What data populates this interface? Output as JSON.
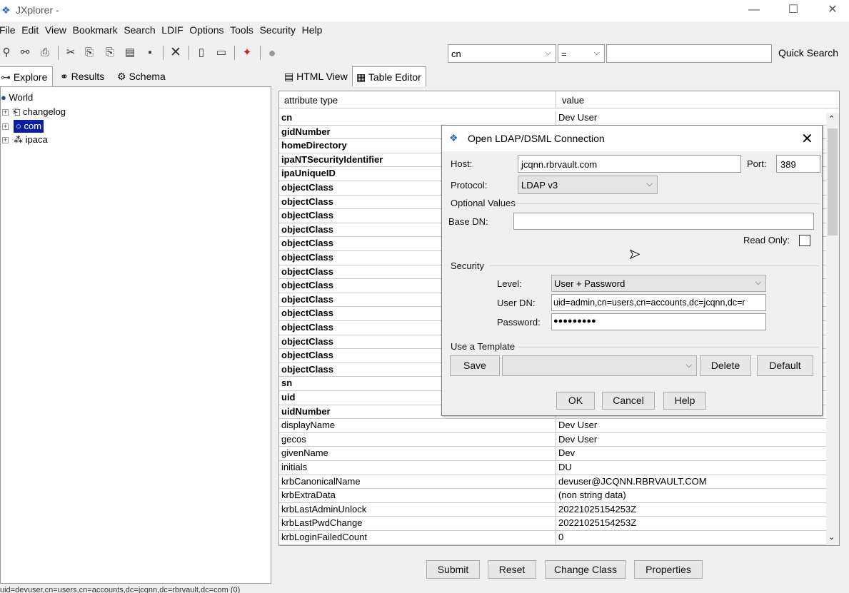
{
  "window": {
    "title": "JXplorer -",
    "minimize": "—",
    "maximize": "☐",
    "close": "✕"
  },
  "menu": [
    "File",
    "Edit",
    "View",
    "Bookmark",
    "Search",
    "LDIF",
    "Options",
    "Tools",
    "Security",
    "Help"
  ],
  "search": {
    "attribute": "cn",
    "operator": "=",
    "value": "",
    "quick_search_label": "Quick Search"
  },
  "left_tabs": [
    "Explore",
    "Results",
    "Schema"
  ],
  "tree": {
    "root": "World",
    "items": [
      "changelog",
      "com",
      "ipaca"
    ]
  },
  "right_tabs": [
    "HTML View",
    "Table Editor"
  ],
  "table": {
    "headers": [
      "attribute type",
      "value"
    ],
    "rows": [
      {
        "attr": "cn",
        "value": "Dev User",
        "bold": true
      },
      {
        "attr": "gidNumber",
        "value": "",
        "bold": true
      },
      {
        "attr": "homeDirectory",
        "value": "",
        "bold": true
      },
      {
        "attr": "ipaNTSecurityIdentifier",
        "value": "",
        "bold": true
      },
      {
        "attr": "ipaUniqueID",
        "value": "",
        "bold": true
      },
      {
        "attr": "objectClass",
        "value": "",
        "bold": true
      },
      {
        "attr": "objectClass",
        "value": "",
        "bold": true
      },
      {
        "attr": "objectClass",
        "value": "",
        "bold": true
      },
      {
        "attr": "objectClass",
        "value": "",
        "bold": true
      },
      {
        "attr": "objectClass",
        "value": "",
        "bold": true
      },
      {
        "attr": "objectClass",
        "value": "",
        "bold": true
      },
      {
        "attr": "objectClass",
        "value": "",
        "bold": true
      },
      {
        "attr": "objectClass",
        "value": "",
        "bold": true
      },
      {
        "attr": "objectClass",
        "value": "",
        "bold": true
      },
      {
        "attr": "objectClass",
        "value": "",
        "bold": true
      },
      {
        "attr": "objectClass",
        "value": "",
        "bold": true
      },
      {
        "attr": "objectClass",
        "value": "",
        "bold": true
      },
      {
        "attr": "objectClass",
        "value": "",
        "bold": true
      },
      {
        "attr": "objectClass",
        "value": "",
        "bold": true
      },
      {
        "attr": "sn",
        "value": "",
        "bold": true
      },
      {
        "attr": "uid",
        "value": "",
        "bold": true
      },
      {
        "attr": "uidNumber",
        "value": "",
        "bold": true
      },
      {
        "attr": "displayName",
        "value": "Dev User",
        "bold": false
      },
      {
        "attr": "gecos",
        "value": "Dev User",
        "bold": false
      },
      {
        "attr": "givenName",
        "value": "Dev",
        "bold": false
      },
      {
        "attr": "initials",
        "value": "DU",
        "bold": false
      },
      {
        "attr": "krbCanonicalName",
        "value": "devuser@JCQNN.RBRVAULT.COM",
        "bold": false
      },
      {
        "attr": "krbExtraData",
        "value": "(non string data)",
        "bold": false
      },
      {
        "attr": "krbLastAdminUnlock",
        "value": "20221025154253Z",
        "bold": false
      },
      {
        "attr": "krbLastPwdChange",
        "value": "20221025154253Z",
        "bold": false
      },
      {
        "attr": "krbLoginFailedCount",
        "value": "0",
        "bold": false
      }
    ]
  },
  "bottom_buttons": [
    "Submit",
    "Reset",
    "Change Class",
    "Properties"
  ],
  "dialog": {
    "title": "Open LDAP/DSML Connection",
    "host_label": "Host:",
    "host": "jcqnn.rbrvault.com",
    "port_label": "Port:",
    "port": "389",
    "protocol_label": "Protocol:",
    "protocol": "LDAP v3",
    "optional_label": "Optional Values",
    "basedn_label": "Base DN:",
    "basedn": "",
    "readonly_label": "Read Only:",
    "security_label": "Security",
    "level_label": "Level:",
    "level": "User + Password",
    "userdn_label": "User DN:",
    "userdn": "uid=admin,cn=users,cn=accounts,dc=jcqnn,dc=r",
    "password_label": "Password:",
    "password": "●●●●●●●●●",
    "template_label": "Use a Template",
    "save": "Save",
    "delete": "Delete",
    "default": "Default",
    "ok": "OK",
    "cancel": "Cancel",
    "help": "Help"
  },
  "status": "uid=devuser,cn=users,cn=accounts,dc=jcqnn,dc=rbrvault,dc=com (0)"
}
